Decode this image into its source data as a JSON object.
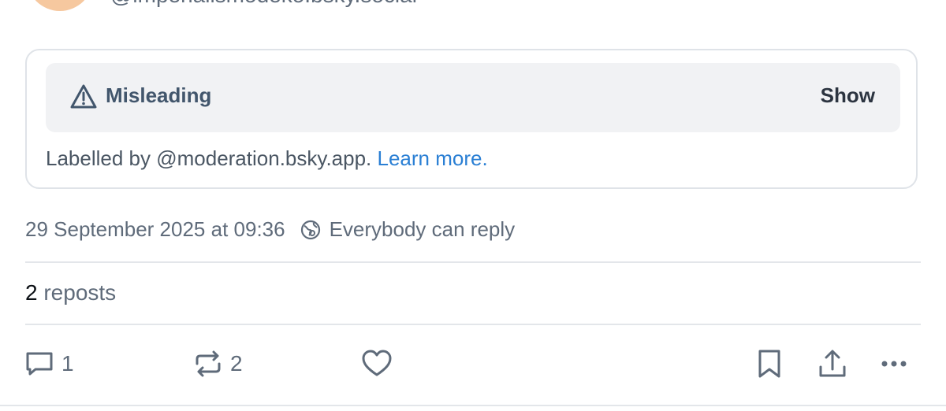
{
  "author": {
    "handle": "@imperialismodeko.bsky.social"
  },
  "moderation": {
    "label": "Misleading",
    "show_label": "Show",
    "labelled_by": "Labelled by @moderation.bsky.app.",
    "learn_more": "Learn more."
  },
  "meta": {
    "timestamp": "29 September 2025 at 09:36",
    "reply_setting": "Everybody can reply"
  },
  "stats": {
    "reposts_count": "2",
    "reposts_label": "reposts"
  },
  "actions": {
    "reply_count": "1",
    "repost_count": "2"
  },
  "colors": {
    "accent": "#2a7fd4",
    "muted_text": "#5f6b7a",
    "label_bg": "#f1f2f4"
  }
}
